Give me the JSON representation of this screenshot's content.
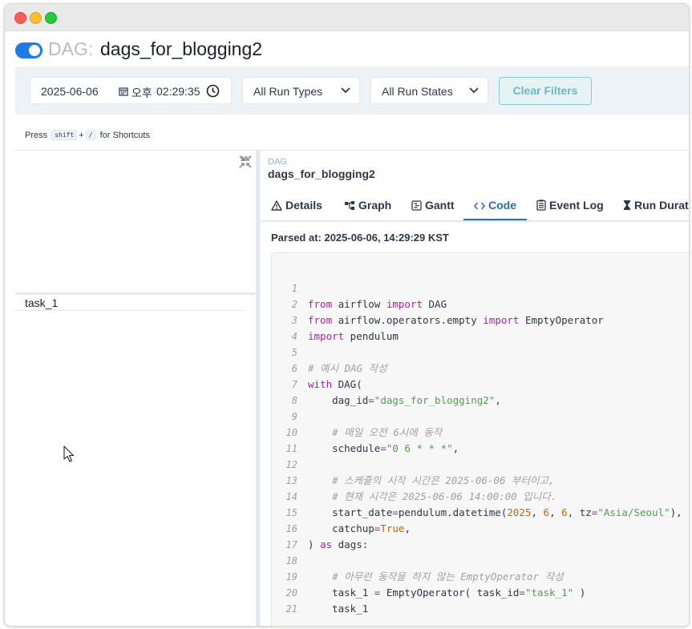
{
  "header": {
    "dag_prefix": "DAG:",
    "dag_title": "dags_for_blogging2"
  },
  "filters": {
    "date": "2025-06-06",
    "ampm": "오후",
    "time": "02:29:35",
    "run_types": "All Run Types",
    "run_states": "All Run States",
    "clear_label": "Clear Filters"
  },
  "shortcut": {
    "press": "Press",
    "key1": "shift",
    "plus": "+",
    "key2": "/",
    "suffix": "for Shortcuts"
  },
  "grid": {
    "tasks": [
      "task_1"
    ]
  },
  "details": {
    "crumb_label": "DAG",
    "crumb_value": "dags_for_blogging2",
    "tabs": [
      "Details",
      "Graph",
      "Gantt",
      "Code",
      "Event Log",
      "Run Duration"
    ],
    "active_tab": "Code",
    "parsed_at": "Parsed at: 2025-06-06, 14:29:29 KST"
  },
  "code": {
    "lines": [
      "1",
      "2",
      "3",
      "4",
      "5",
      "6",
      "7",
      "8",
      "9",
      "10",
      "11",
      "12",
      "13",
      "14",
      "15",
      "16",
      "17",
      "18",
      "19",
      "20",
      "21"
    ],
    "t": {
      "from": "from",
      "import": "import",
      "airflow": " airflow ",
      "dag": " DAG",
      "airflow_ops": " airflow.operators.empty ",
      "empty_op": " EmptyOperator",
      "pendulum": " pendulum",
      "c5": "# 예시 DAG 작성",
      "with": "with",
      "dag_open": " DAG(",
      "dag_id_key": "    dag_id",
      "eq": "=",
      "dag_id_val": "\"dags_for_blogging2\"",
      "comma": ",",
      "c9": "    # 매일 오전 6시에 동작",
      "schedule_key": "    schedule",
      "schedule_val": "\"0 6 * * *\"",
      "c12": "    # 스케줄의 시작 시간은 2025-06-06 부터이고,",
      "c13": "    # 현재 시각은 2025-06-06 14:00:00 입니다.",
      "start_key": "    start_date",
      "start_mid": "pendulum.datetime(",
      "n2025": "2025",
      "sep": ", ",
      "n6": "6",
      "tz_key": "tz",
      "tz_val": "\"Asia/Seoul\"",
      "close": "),",
      "catchup_key": "    catchup",
      "true_val": "True",
      "paren_close": ")",
      "as": "as",
      "dags": " dags:",
      "c18": "    # 아무런 동작을 하지 않는 EmptyOperator 작성",
      "task_assign": "    task_1 ",
      "task_call": " EmptyOperator( task_id",
      "task_id_val": "\"task_1\"",
      "task_end": " )",
      "task_ref": "    task_1",
      "space": " "
    }
  },
  "colors": {
    "toggle": "#1e7ae6",
    "active_tab": "#2b6cb0",
    "keyword": "#a626a4",
    "string": "#50a14f",
    "number": "#b76b01"
  }
}
